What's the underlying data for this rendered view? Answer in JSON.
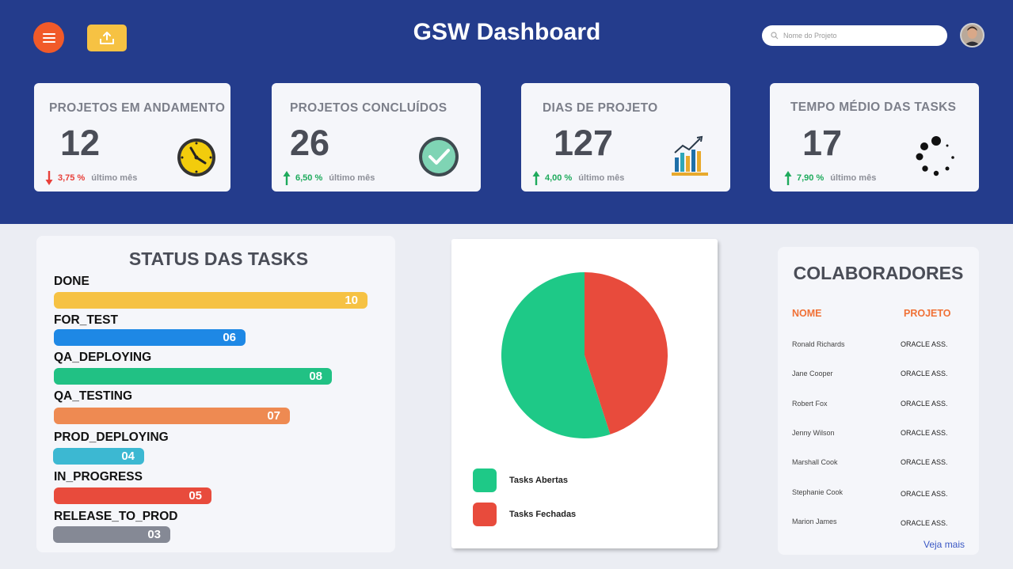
{
  "header": {
    "title": "GSW Dashboard",
    "search": {
      "placeholder": "Nome do Projeto"
    },
    "colors": {
      "background": "#243c8c",
      "menu_button": "#f15a29",
      "upload_button": "#f6c243"
    }
  },
  "stats": [
    {
      "title": "PROJETOS EM ANDAMENTO",
      "value": "12",
      "trend": "down",
      "pct": "3,75 %",
      "label": "último mês",
      "color": "#e8403a",
      "icon": "clock-icon"
    },
    {
      "title": "PROJETOS CONCLUÍDOS",
      "value": "26",
      "trend": "up",
      "pct": "6,50 %",
      "label": "último mês",
      "color": "#1eaa5c",
      "icon": "check-circle-icon"
    },
    {
      "title": "DIAS DE PROJETO",
      "value": "127",
      "trend": "up",
      "pct": "4,00 %",
      "label": "último mês",
      "color": "#1eaa5c",
      "icon": "growth-chart-icon"
    },
    {
      "title": "TEMPO MÉDIO DAS TASKS",
      "value": "17",
      "trend": "up",
      "pct": "7,90 %",
      "label": "último mês",
      "color": "#1eaa5c",
      "icon": "loading-spinner-icon"
    }
  ],
  "status_tasks": {
    "title": "STATUS DAS TASKS",
    "items": [
      {
        "label": "DONE",
        "value": "10",
        "color": "#f6c243"
      },
      {
        "label": "FOR_TEST",
        "value": "06",
        "color": "#1e88e5"
      },
      {
        "label": "QA_DEPLOYING",
        "value": "08",
        "color": "#21c184"
      },
      {
        "label": "QA_TESTING",
        "value": "07",
        "color": "#ee8a52"
      },
      {
        "label": "PROD_DEPLOYING",
        "value": "04",
        "color": "#3cb8d2"
      },
      {
        "label": "IN_PROGRESS",
        "value": "05",
        "color": "#e84b3c"
      },
      {
        "label": "RELEASE_TO_PROD",
        "value": "03",
        "color": "#858995"
      }
    ]
  },
  "chart_data": {
    "type": "pie",
    "title": "",
    "series": [
      {
        "name": "Tasks Abertas",
        "value": 55,
        "color": "#1ec987"
      },
      {
        "name": "Tasks Fechadas",
        "value": 45,
        "color": "#e84b3c"
      }
    ],
    "legend": "bottom-left"
  },
  "collaborators": {
    "title": "COLABORADORES",
    "col_name": "NOME",
    "col_project": "PROJETO",
    "rows": [
      {
        "name": "Ronald Richards",
        "project": "ORACLE ASS."
      },
      {
        "name": "Jane Cooper",
        "project": "ORACLE ASS."
      },
      {
        "name": "Robert Fox",
        "project": "ORACLE ASS."
      },
      {
        "name": "Jenny Wilson",
        "project": "ORACLE ASS."
      },
      {
        "name": "Marshall Cook",
        "project": "ORACLE ASS."
      },
      {
        "name": "Stephanie Cook",
        "project": "ORACLE ASS."
      },
      {
        "name": "Marion James",
        "project": "ORACLE ASS."
      }
    ],
    "more_link": "Veja mais"
  }
}
